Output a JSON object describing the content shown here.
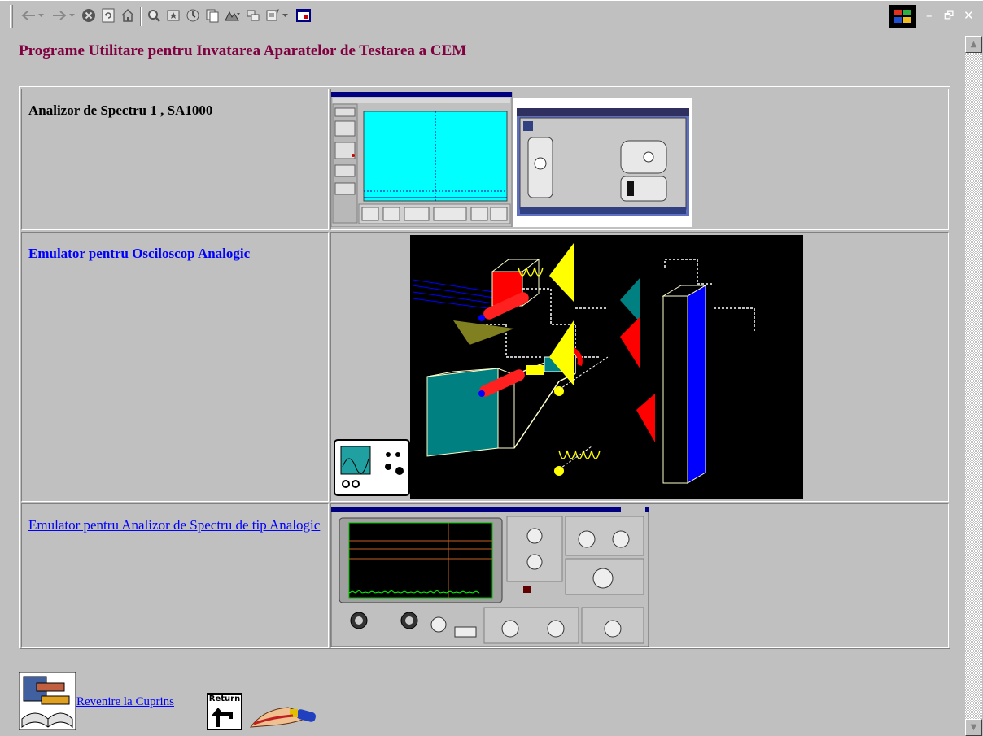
{
  "page": {
    "title": "Programe Utilitare pentru Invatarea Aparatelor de Testarea a CEM"
  },
  "rows": [
    {
      "label": "Analizor de Spectru 1  , SA1000",
      "style": "bold-text",
      "image": "spectrum-analyzer-sa1000-screenshot"
    },
    {
      "label": "Emulator pentru Osciloscop Analogic",
      "style": "bold-link",
      "image": "oscilloscope-diagram"
    },
    {
      "label": "Emulator pentru Analizor de Spectru de tip Analogic",
      "style": "link",
      "image": "analog-spectrum-analyzer-panel"
    }
  ],
  "footer": {
    "link": "Revenire la Cuprins",
    "return_icon_text": "Return"
  },
  "window": {
    "controls": [
      "–",
      "🗗",
      "✕"
    ]
  },
  "colors": {
    "title": "#800040",
    "link": "#0000ff",
    "background": "#c0c0c0"
  }
}
